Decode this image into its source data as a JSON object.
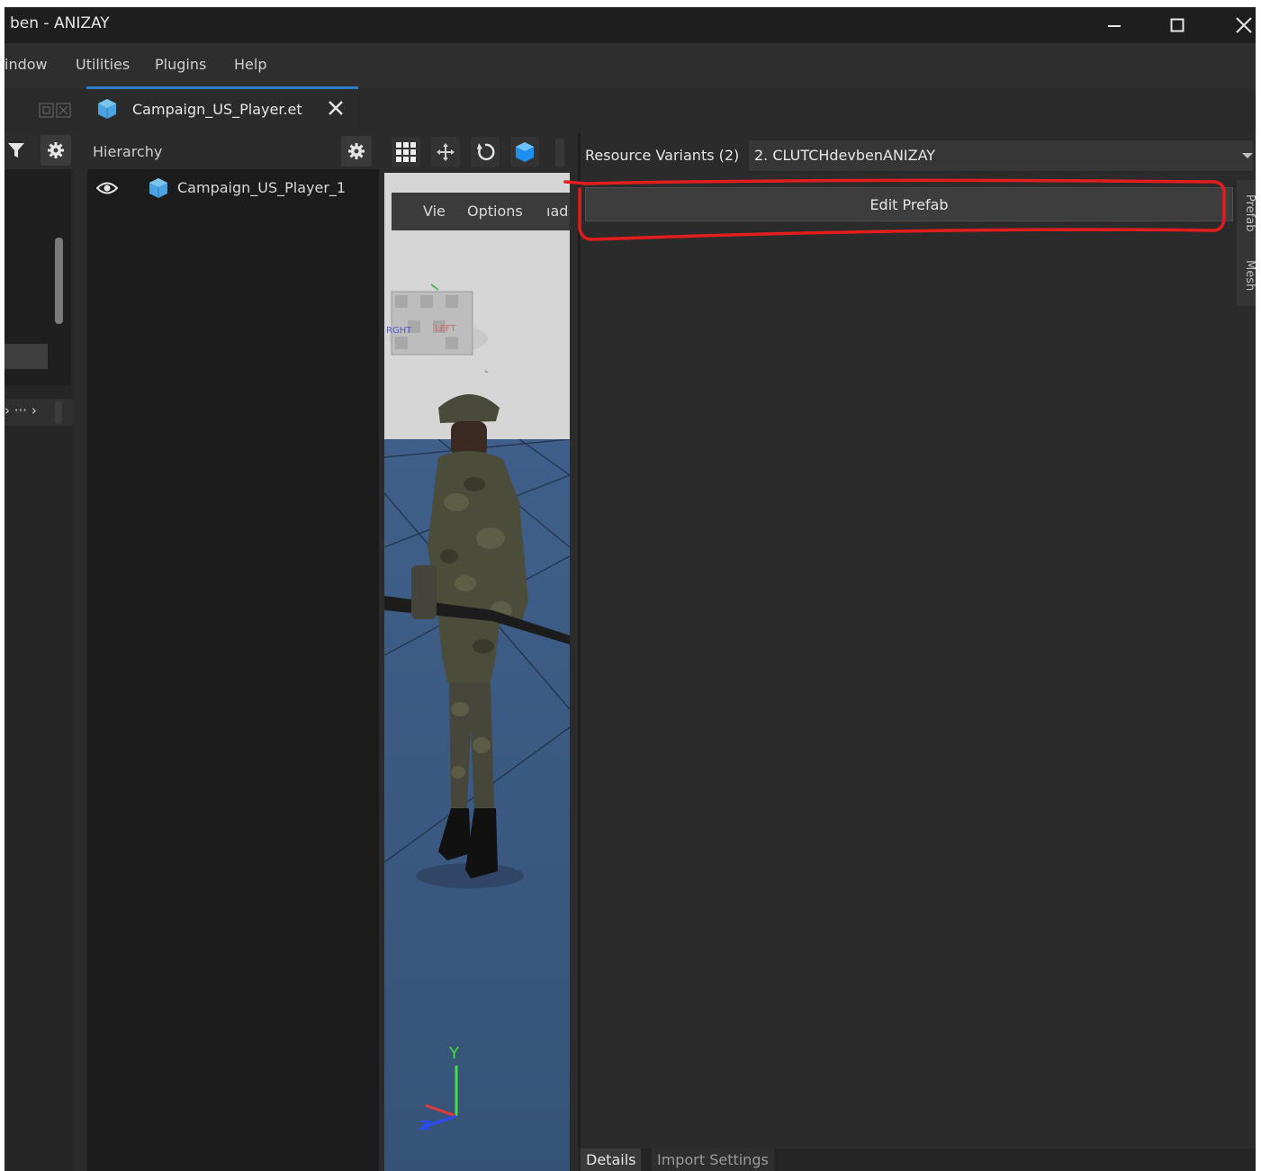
{
  "window": {
    "title": "ben - ANIZAY"
  },
  "menu": {
    "items": [
      "indow",
      "Utilities",
      "Plugins",
      "Help"
    ]
  },
  "tab": {
    "label": "Campaign_US_Player.et"
  },
  "left_dock": {
    "breadcrumb": "› ··· ›"
  },
  "hierarchy": {
    "title": "Hierarchy",
    "item_label": "Campaign_US_Player_1"
  },
  "viewport": {
    "menu_items": [
      "Vie",
      "Options",
      "ıad"
    ],
    "gizmo_labels": [
      "RGHT",
      "LEFT"
    ],
    "axis_y": "Y"
  },
  "right_panel": {
    "variants_label": "Resource Variants (2)",
    "variants_value": "2. CLUTCHdevbenANIZAY",
    "edit_prefab_label": "Edit Prefab",
    "side_tabs": [
      "Prefab",
      "Mesh"
    ],
    "bottom_tabs": [
      "Details",
      "Import Settings"
    ]
  },
  "colors": {
    "accent": "#2f7bc8",
    "annotation": "#e11d1d",
    "cube_icon": "#4aa3e0"
  }
}
